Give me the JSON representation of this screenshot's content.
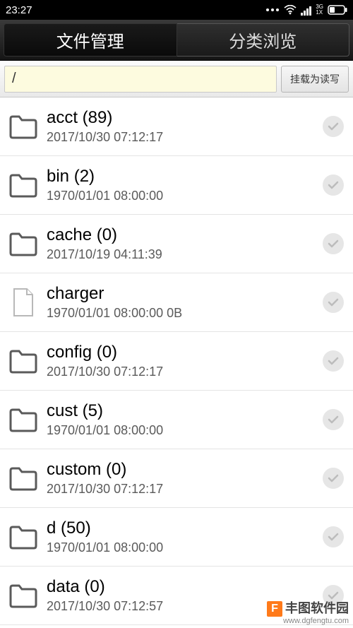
{
  "status": {
    "time": "23:27",
    "signal_label": "3G"
  },
  "tabs": {
    "left": "文件管理",
    "right": "分类浏览"
  },
  "pathbar": {
    "path": "/",
    "mount_btn": "挂载为读写"
  },
  "items": [
    {
      "kind": "folder",
      "name": "acct",
      "count": "(89)",
      "sub": "2017/10/30 07:12:17"
    },
    {
      "kind": "folder",
      "name": "bin",
      "count": "(2)",
      "sub": "1970/01/01 08:00:00"
    },
    {
      "kind": "folder",
      "name": "cache",
      "count": "(0)",
      "sub": "2017/10/19 04:11:39"
    },
    {
      "kind": "file",
      "name": "charger",
      "count": "",
      "sub": "1970/01/01 08:00:00   0B"
    },
    {
      "kind": "folder",
      "name": "config",
      "count": "(0)",
      "sub": "2017/10/30 07:12:17"
    },
    {
      "kind": "folder",
      "name": "cust",
      "count": "(5)",
      "sub": "1970/01/01 08:00:00"
    },
    {
      "kind": "folder",
      "name": "custom",
      "count": "(0)",
      "sub": "2017/10/30 07:12:17"
    },
    {
      "kind": "folder",
      "name": "d",
      "count": "(50)",
      "sub": "1970/01/01 08:00:00"
    },
    {
      "kind": "folder",
      "name": "data",
      "count": "(0)",
      "sub": "2017/10/30 07:12:57"
    }
  ],
  "watermark": {
    "logo": "F",
    "text1": "丰图软件园",
    "text2": "www.dgfengtu.com"
  }
}
